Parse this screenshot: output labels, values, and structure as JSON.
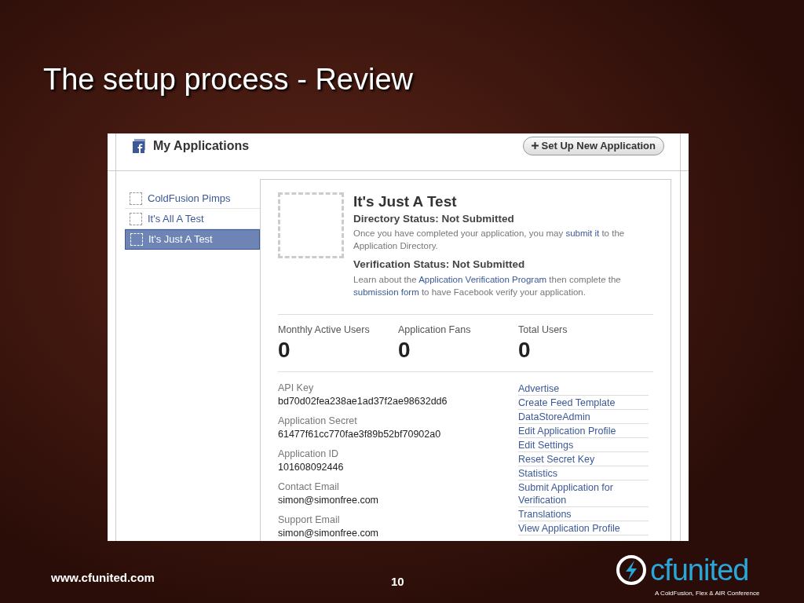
{
  "slide": {
    "title": "The setup process - Review",
    "footer_url": "www.cfunited.com",
    "page_number": "10",
    "logo": {
      "name": "cfunited",
      "tagline": "A ColdFusion, Flex & AIR Conference"
    }
  },
  "app": {
    "title": "My Applications",
    "new_button": "Set Up New Application",
    "sidebar": [
      {
        "label": "ColdFusion Pimps",
        "selected": false
      },
      {
        "label": "It's All A Test",
        "selected": false
      },
      {
        "label": "It's Just A Test",
        "selected": true
      }
    ],
    "name": "It's Just A Test",
    "statuses": [
      {
        "heading": "Directory Status: Not Submitted",
        "text": [
          {
            "text": "Once you have completed your application, you may ",
            "link": false
          },
          {
            "text": "submit it",
            "link": true
          },
          {
            "text": " to the Application Directory.",
            "link": false
          }
        ]
      },
      {
        "heading": "Verification Status: Not Submitted",
        "text": [
          {
            "text": "Learn about the ",
            "link": false
          },
          {
            "text": "Application Verification Program",
            "link": true
          },
          {
            "text": " then complete the ",
            "link": false
          },
          {
            "text": "submission form",
            "link": true
          },
          {
            "text": " to have Facebook verify your application.",
            "link": false
          }
        ]
      }
    ],
    "stats": [
      {
        "label": "Monthly Active Users",
        "value": "0"
      },
      {
        "label": "Application Fans",
        "value": "0"
      },
      {
        "label": "Total Users",
        "value": "0"
      }
    ],
    "fields": [
      {
        "label": "API Key",
        "value": "bd70d02fea238ae1ad37f2ae98632dd6"
      },
      {
        "label": "Application Secret",
        "value": "61477f61cc770fae3f89b52bf70902a0"
      },
      {
        "label": "Application ID",
        "value": "101608092446"
      },
      {
        "label": "Contact Email",
        "value": "simon@simonfree.com"
      },
      {
        "label": "Support Email",
        "value": "simon@simonfree.com"
      }
    ],
    "links": [
      "Advertise",
      "Create Feed Template",
      "DataStoreAdmin",
      "Edit Application Profile",
      "Edit Settings",
      "Reset Secret Key",
      "Statistics",
      "Submit Application for Verification",
      "Translations",
      "View Application Profile"
    ]
  }
}
